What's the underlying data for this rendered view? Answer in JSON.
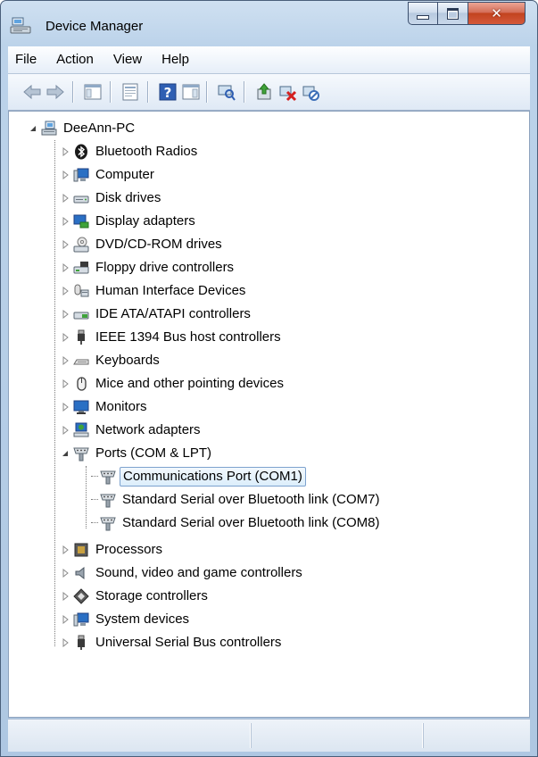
{
  "window": {
    "title": "Device Manager"
  },
  "menu": {
    "items": [
      {
        "label": "File"
      },
      {
        "label": "Action"
      },
      {
        "label": "View"
      },
      {
        "label": "Help"
      }
    ]
  },
  "toolbar": {
    "buttons": [
      {
        "icon": "back-arrow-icon"
      },
      {
        "icon": "forward-arrow-icon"
      },
      {
        "icon": "show-hide-console-tree-icon"
      },
      {
        "icon": "properties-icon"
      },
      {
        "icon": "help-icon"
      },
      {
        "icon": "show-action-pane-icon"
      },
      {
        "icon": "scan-hardware-changes-icon"
      },
      {
        "icon": "update-driver-icon"
      },
      {
        "icon": "uninstall-device-icon"
      },
      {
        "icon": "disable-device-icon"
      }
    ]
  },
  "tree": {
    "root": {
      "label": "DeeAnn-PC",
      "icon": "computer-network-icon",
      "expanded": true
    },
    "categories": [
      {
        "label": "Bluetooth Radios",
        "icon": "bluetooth-icon"
      },
      {
        "label": "Computer",
        "icon": "computer-icon"
      },
      {
        "label": "Disk drives",
        "icon": "disk-drive-icon"
      },
      {
        "label": "Display adapters",
        "icon": "display-adapter-icon"
      },
      {
        "label": "DVD/CD-ROM drives",
        "icon": "dvd-drive-icon"
      },
      {
        "label": "Floppy drive controllers",
        "icon": "floppy-controller-icon"
      },
      {
        "label": "Human Interface Devices",
        "icon": "hid-icon"
      },
      {
        "label": "IDE ATA/ATAPI controllers",
        "icon": "ide-controller-icon"
      },
      {
        "label": "IEEE 1394 Bus host controllers",
        "icon": "firewire-icon"
      },
      {
        "label": "Keyboards",
        "icon": "keyboard-icon"
      },
      {
        "label": "Mice and other pointing devices",
        "icon": "mouse-icon"
      },
      {
        "label": "Monitors",
        "icon": "monitor-icon"
      },
      {
        "label": "Network adapters",
        "icon": "network-adapter-icon"
      },
      {
        "label": "Ports (COM & LPT)",
        "icon": "port-icon",
        "expanded": true,
        "children": [
          {
            "label": "Communications Port (COM1)",
            "icon": "port-icon",
            "selected": true
          },
          {
            "label": "Standard Serial over Bluetooth link (COM7)",
            "icon": "port-icon"
          },
          {
            "label": "Standard Serial over Bluetooth link (COM8)",
            "icon": "port-icon"
          }
        ]
      },
      {
        "label": "Processors",
        "icon": "processor-icon"
      },
      {
        "label": "Sound, video and game controllers",
        "icon": "sound-icon"
      },
      {
        "label": "Storage controllers",
        "icon": "storage-controller-icon"
      },
      {
        "label": "System devices",
        "icon": "system-devices-icon"
      },
      {
        "label": "Universal Serial Bus controllers",
        "icon": "usb-icon"
      }
    ]
  },
  "colors": {
    "selection_border": "#7da2ce",
    "close_button": "#c2431f"
  }
}
